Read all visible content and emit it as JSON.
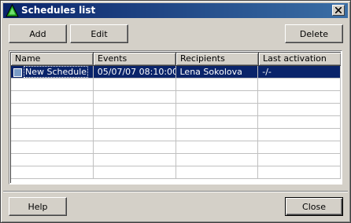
{
  "window": {
    "title": "Schedules list",
    "app_icon": "green-triangle-icon",
    "close_icon": "close-icon"
  },
  "toolbar": {
    "add_label": "Add",
    "edit_label": "Edit",
    "delete_label": "Delete"
  },
  "table": {
    "columns": [
      "Name",
      "Events",
      "Recipients",
      "Last activation"
    ],
    "rows": [
      {
        "name": "New Schedule",
        "events": "05/07/07 08:10:00",
        "recipients": "Lena Sokolova",
        "last_activation": "-/-",
        "selected": true
      }
    ]
  },
  "footer": {
    "help_label": "Help",
    "close_label": "Close"
  },
  "colors": {
    "title_start": "#0a246a",
    "title_end": "#3a6ea5",
    "selection": "#0a246a",
    "face": "#d4d0c8"
  }
}
